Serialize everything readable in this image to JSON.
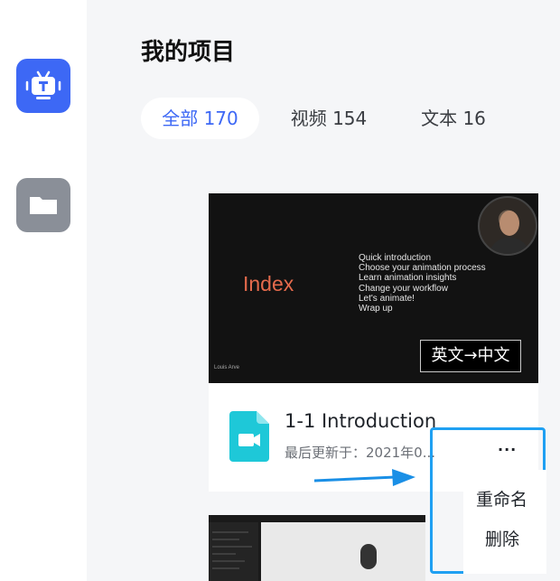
{
  "page": {
    "title": "我的项目"
  },
  "tabs": [
    {
      "label": "全部",
      "count": "170",
      "active": true
    },
    {
      "label": "视频",
      "count": "154",
      "active": false
    },
    {
      "label": "文本",
      "count": "16",
      "active": false
    }
  ],
  "card": {
    "thumbnail": {
      "heading": "Index",
      "outline": [
        "Quick introduction",
        "Choose your animation process",
        "Learn animation insights",
        "Change your workflow",
        "Let's animate!",
        "Wrap up"
      ],
      "presenter_caption": "Louis Arve",
      "translation_badge": "英文→中文"
    },
    "title": "1-1 Introduction",
    "meta": "最后更新于：2021年0..."
  },
  "context_menu": {
    "more": "···",
    "items": [
      {
        "label": "重命名"
      },
      {
        "label": "删除"
      }
    ]
  },
  "colors": {
    "accent": "#3d68f5",
    "highlight_border": "#1fa0f2",
    "file_icon": "#1ec8d8",
    "index_text": "#e46a4c"
  }
}
